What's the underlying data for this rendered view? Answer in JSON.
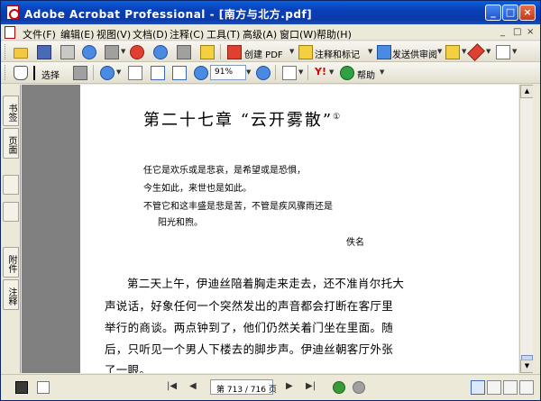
{
  "window": {
    "title": "Adobe Acrobat Professional - [南方与北方.pdf]",
    "controls": [
      "_",
      "□",
      "×"
    ]
  },
  "menubar": {
    "items": [
      "文件(F)",
      "编辑(E)",
      "视图(V)",
      "文档(D)",
      "注释(C)",
      "工具(T)",
      "高级(A)",
      "窗口(W)",
      "帮助(H)"
    ],
    "doc_controls": [
      "_",
      "□",
      "×"
    ]
  },
  "toolbar1": {
    "create_pdf": "创建 PDF",
    "comment_markup": "注释和标记",
    "send_review": "发送供审阅"
  },
  "toolbar2": {
    "select": "选择",
    "zoom_value": "91%",
    "help": "帮助"
  },
  "navpanel": {
    "tabs": [
      "书签",
      "页面",
      "附件",
      "注释"
    ]
  },
  "document": {
    "chapter_title": "第二十七章 “云开雾散”",
    "footnote_mark": "①",
    "epigraph": [
      "任它是欢乐或是悲哀，是希望或是恐惧，",
      "今生如此，来世也是如此。",
      "不管它和这丰盛是悲是苦，不管是疾风骤雨还是",
      "阳光和煦。"
    ],
    "epigraph_author": "佚名",
    "body": [
      "第二天上午，伊迪丝陪着胸走来走去，还不准肖尔托大",
      "声说话，好象任何一个突然发出的声音都会打断在客厅里",
      "举行的商谈。两点钟到了，他们仍然关着门坐在里面。随",
      "后，只听见一个男人下楼去的脚步声。伊迪丝朝客厅外张",
      "了一眼。"
    ]
  },
  "statusbar": {
    "page_indicator": "第 713 / 716 页"
  }
}
